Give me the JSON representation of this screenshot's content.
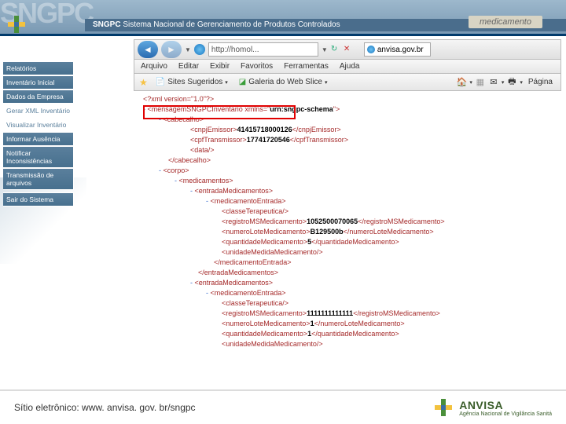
{
  "header": {
    "bg_logo_text": "SNGPC",
    "title_bold": "SNGPC",
    "title_rest": "Sistema Nacional de Gerenciamento de Produtos Controlados",
    "med_label": "medicamento"
  },
  "browser": {
    "url_value": "http://homol...",
    "tab_label": "anvisa.gov.br",
    "menu": [
      "Arquivo",
      "Editar",
      "Exibir",
      "Favoritos",
      "Ferramentas",
      "Ajuda"
    ],
    "tb_sug": "Sites Sugeridos",
    "tb_gal": "Galeria do Web Slice",
    "tb_page": "Página"
  },
  "sidebar": {
    "items": [
      {
        "label": "Relatórios"
      },
      {
        "label": "Inventário Inicial"
      },
      {
        "label": "Dados da Empresa"
      },
      {
        "label": "Gerar XML Inventário"
      },
      {
        "label": "Visualizar Inventário"
      },
      {
        "label": "Informar Ausência"
      },
      {
        "label": "Notificar Inconsistências"
      },
      {
        "label": "Transmissão de arquivos"
      },
      {
        "label": "Sair do Sistema"
      }
    ]
  },
  "xml": {
    "l0": "<?xml version=\"1.0\"?>",
    "l1a": "<mensagemSNGPCInventario",
    "l1b": " xmlns=\"",
    "l1c": "urn:sngpc-schema",
    "l1d": "\">",
    "l2": "<cabecalho>",
    "cnpj_o": "<cnpjEmissor>",
    "cnpj_v": "41415718000126",
    "cnpj_c": "</cnpjEmissor>",
    "cpf_o": "<cpfTransmissor>",
    "cpf_v": "17741720546",
    "cpf_c": "</cpfTransmissor>",
    "data": "<data/>",
    "cab_c": "</cabecalho>",
    "corpo_o": "<corpo>",
    "med_o": "<medicamentos>",
    "ent_o": "<entradaMedicamentos>",
    "mede_o": "<medicamentoEntrada>",
    "classe": "<classeTerapeutica/>",
    "reg_o": "<registroMSMedicamento>",
    "reg1": "1052500070065",
    "reg_c": "</registroMSMedicamento>",
    "lote_o": "<numeroLoteMedicamento>",
    "lote1": "B129500b",
    "lote_c": "</numeroLoteMedicamento>",
    "qtd_o": "<quantidadeMedicamento>",
    "qtd1": "5",
    "qtd_c": "</quantidadeMedicamento>",
    "uni": "<unidadeMedidaMedicamento/>",
    "mede_c": "</medicamentoEntrada>",
    "ent_c": "</entradaMedicamentos>",
    "reg2": "1111111111111",
    "lote2": "1",
    "qtd2": "1"
  },
  "footer": {
    "site": "Sítio eletrônico: www. anvisa. gov. br/sngpc",
    "brand": "ANVISA",
    "brand_sub": "Agência Nacional de Vigilância Sanitá"
  }
}
